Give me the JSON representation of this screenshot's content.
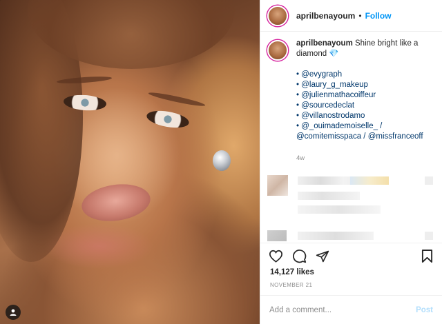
{
  "post": {
    "photo_icon": "person-tag-icon"
  },
  "header": {
    "username": "aprilbenayoum",
    "separator": "•",
    "follow_label": "Follow"
  },
  "caption": {
    "username": "aprilbenayoum",
    "text": "Shine bright like a diamond",
    "emoji": "💎",
    "tags": [
      "• @evygraph",
      "• @laury_g_makeup",
      "• @julienmathacoiffeur",
      "• @sourcedeclat",
      "• @villanostrodamo",
      "• @_ouimademoiselle_ /",
      "@comitemisspaca / @missfranceoff"
    ],
    "age": "4w"
  },
  "actions": {
    "like_icon": "heart-icon",
    "comment_icon": "comment-icon",
    "share_icon": "share-icon",
    "save_icon": "bookmark-icon"
  },
  "likes": "14,127 likes",
  "date": "NOVEMBER 21",
  "comment_input": {
    "placeholder": "Add a comment...",
    "post_label": "Post"
  },
  "colors": {
    "accent": "#0095f6",
    "post_disabled": "#b3dffc",
    "muted": "#8e8e8e",
    "text": "#262626"
  }
}
